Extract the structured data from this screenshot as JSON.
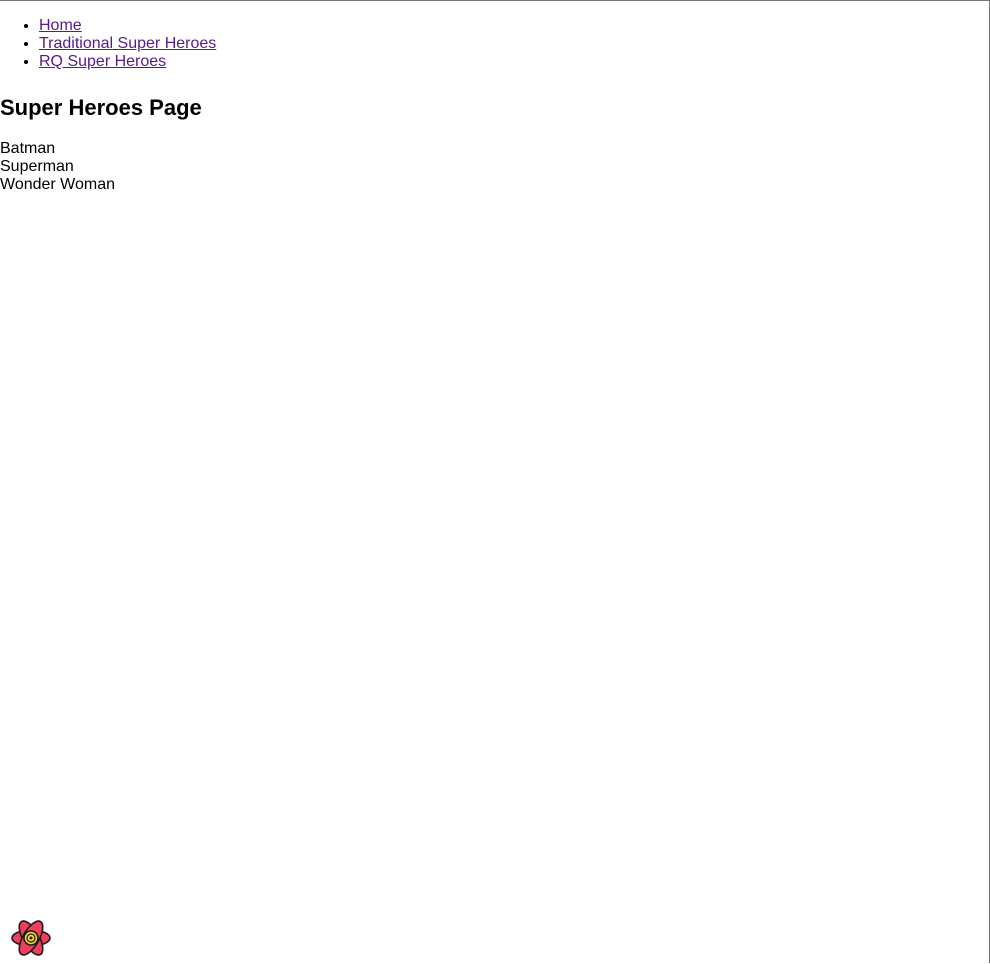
{
  "nav": {
    "links": [
      {
        "label": "Home"
      },
      {
        "label": "Traditional Super Heroes"
      },
      {
        "label": "RQ Super Heroes"
      }
    ]
  },
  "page": {
    "title": "Super Heroes Page"
  },
  "heroes": [
    "Batman",
    "Superman",
    "Wonder Woman"
  ],
  "devtools": {
    "icon": "react-query-flower-icon",
    "colors": {
      "petal": "#ef3f5c",
      "outline": "#1a1a1a",
      "center": "#f4d93b"
    }
  }
}
